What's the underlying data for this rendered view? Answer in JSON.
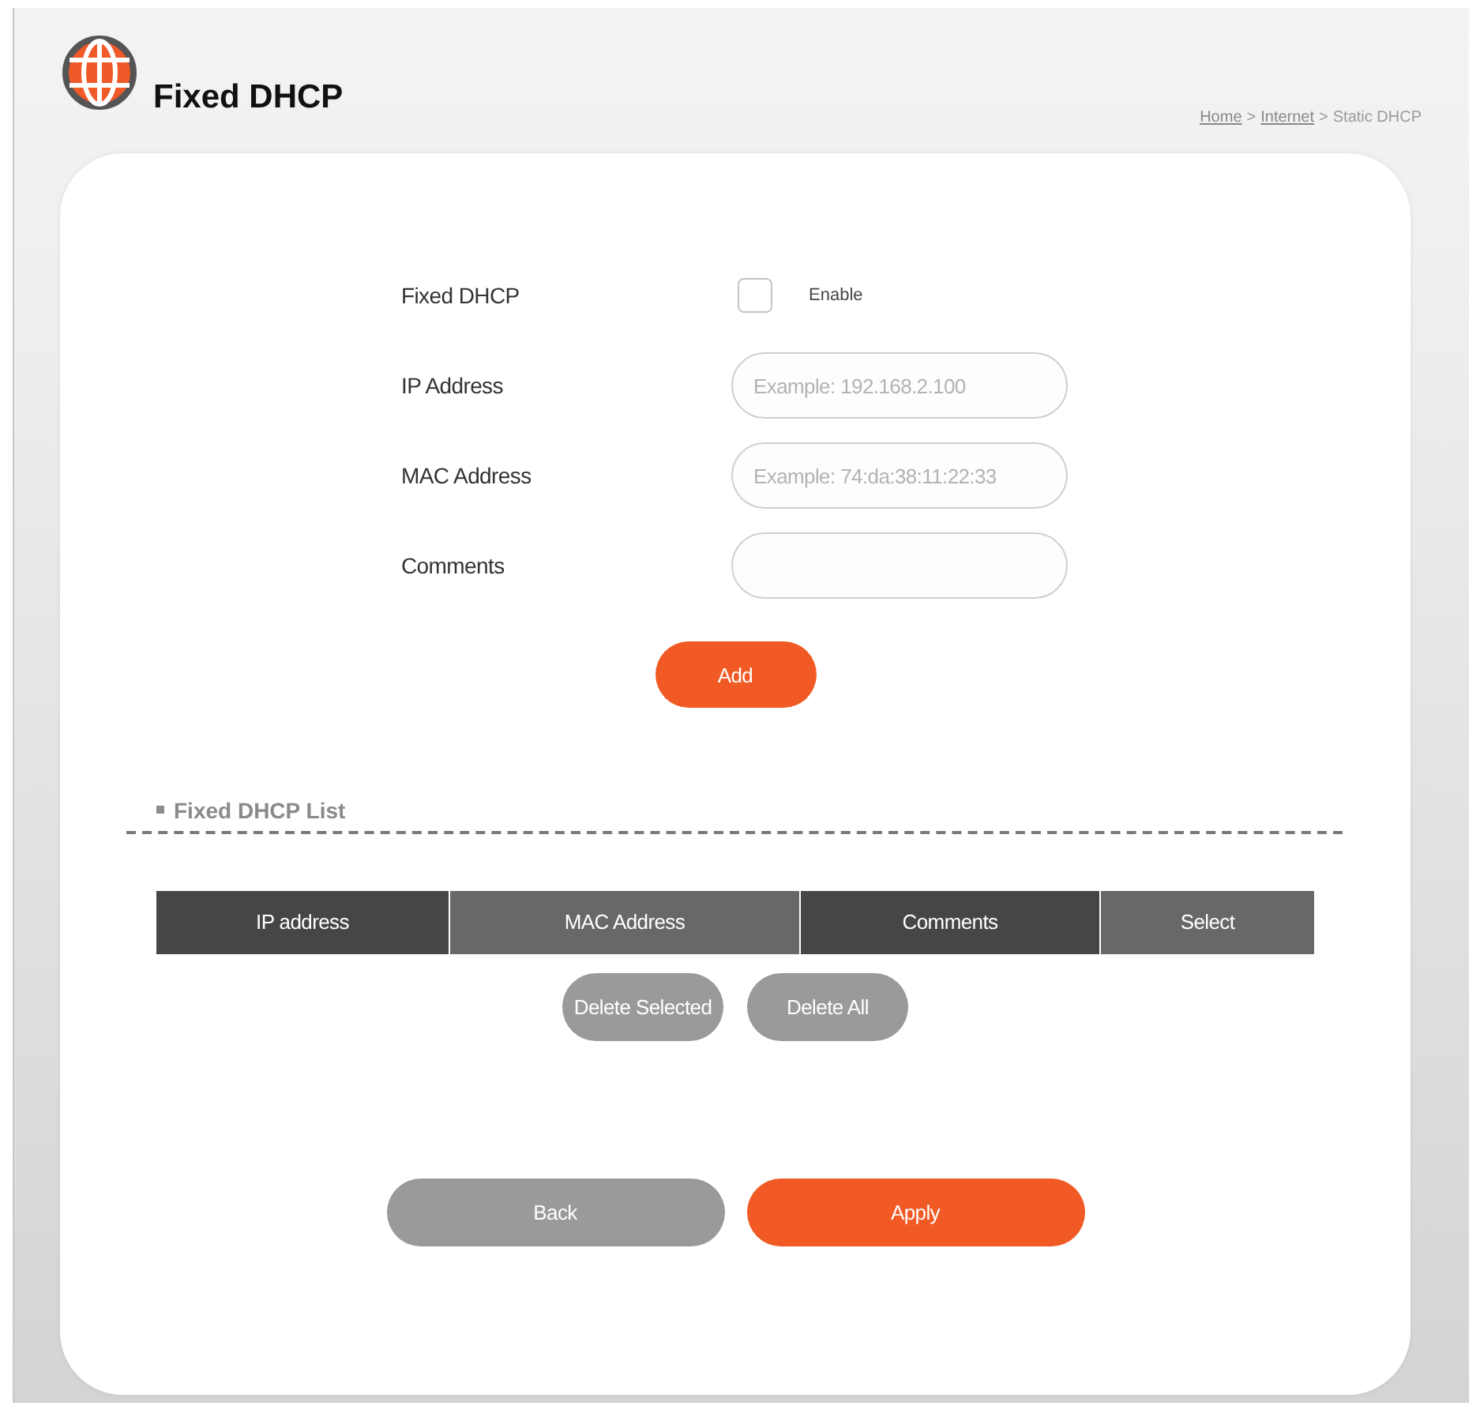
{
  "header": {
    "title": "Fixed DHCP",
    "breadcrumb": [
      {
        "kind": "link",
        "label": "Home"
      },
      {
        "kind": "separator",
        "label": ">"
      },
      {
        "kind": "link",
        "label": "Internet"
      },
      {
        "kind": "separator",
        "label": ">"
      },
      {
        "kind": "current",
        "label": "Static DHCP"
      }
    ]
  },
  "form": {
    "fields": [
      {
        "kind": "checkbox",
        "label": "Fixed DHCP",
        "checked": false,
        "option": "Enable"
      },
      {
        "kind": "text",
        "label": "IP Address",
        "placeholder": "Example: 192.168.2.100"
      },
      {
        "kind": "text",
        "label": "MAC Address",
        "placeholder": "Example: 74:da:38:11:22:33"
      },
      {
        "kind": "text",
        "label": "Comments"
      }
    ],
    "add_button": {
      "label": "Add",
      "kind": "primary"
    }
  },
  "list": {
    "title": "Fixed DHCP List",
    "columns": [
      "IP address",
      "MAC Address",
      "Comments",
      "Select"
    ],
    "buttons": [
      {
        "label": "Delete Selected",
        "kind": "secondary"
      },
      {
        "label": "Delete All",
        "kind": "secondary"
      }
    ]
  },
  "footer_buttons": [
    {
      "label": "Back",
      "kind": "secondary"
    },
    {
      "label": "Apply",
      "kind": "primary"
    }
  ]
}
